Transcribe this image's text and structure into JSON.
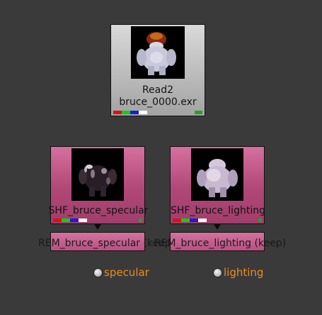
{
  "colors": {
    "background": "#3a3a3a",
    "read_node": "#c0c0c0",
    "shuffle_node": "#b04777",
    "output_label": "#f08b1c",
    "channel_red": "#e01010",
    "channel_green": "#10d010",
    "channel_blue": "#1420d8",
    "channel_white": "#ffffff",
    "mask_green": "#23a323"
  },
  "read_node": {
    "name": "Read2",
    "file": "bruce_0000.exr"
  },
  "shuffle_nodes": [
    {
      "label": "SHF_bruce_specular"
    },
    {
      "label": "SHF_bruce_lighting"
    }
  ],
  "remove_nodes": [
    {
      "label": "REM_bruce_specular (keep)"
    },
    {
      "label": "REM_bruce_lighting (keep)"
    }
  ],
  "outputs": [
    {
      "label": "specular",
      "icon": "output-dot-icon"
    },
    {
      "label": "lighting",
      "icon": "output-dot-icon"
    }
  ]
}
